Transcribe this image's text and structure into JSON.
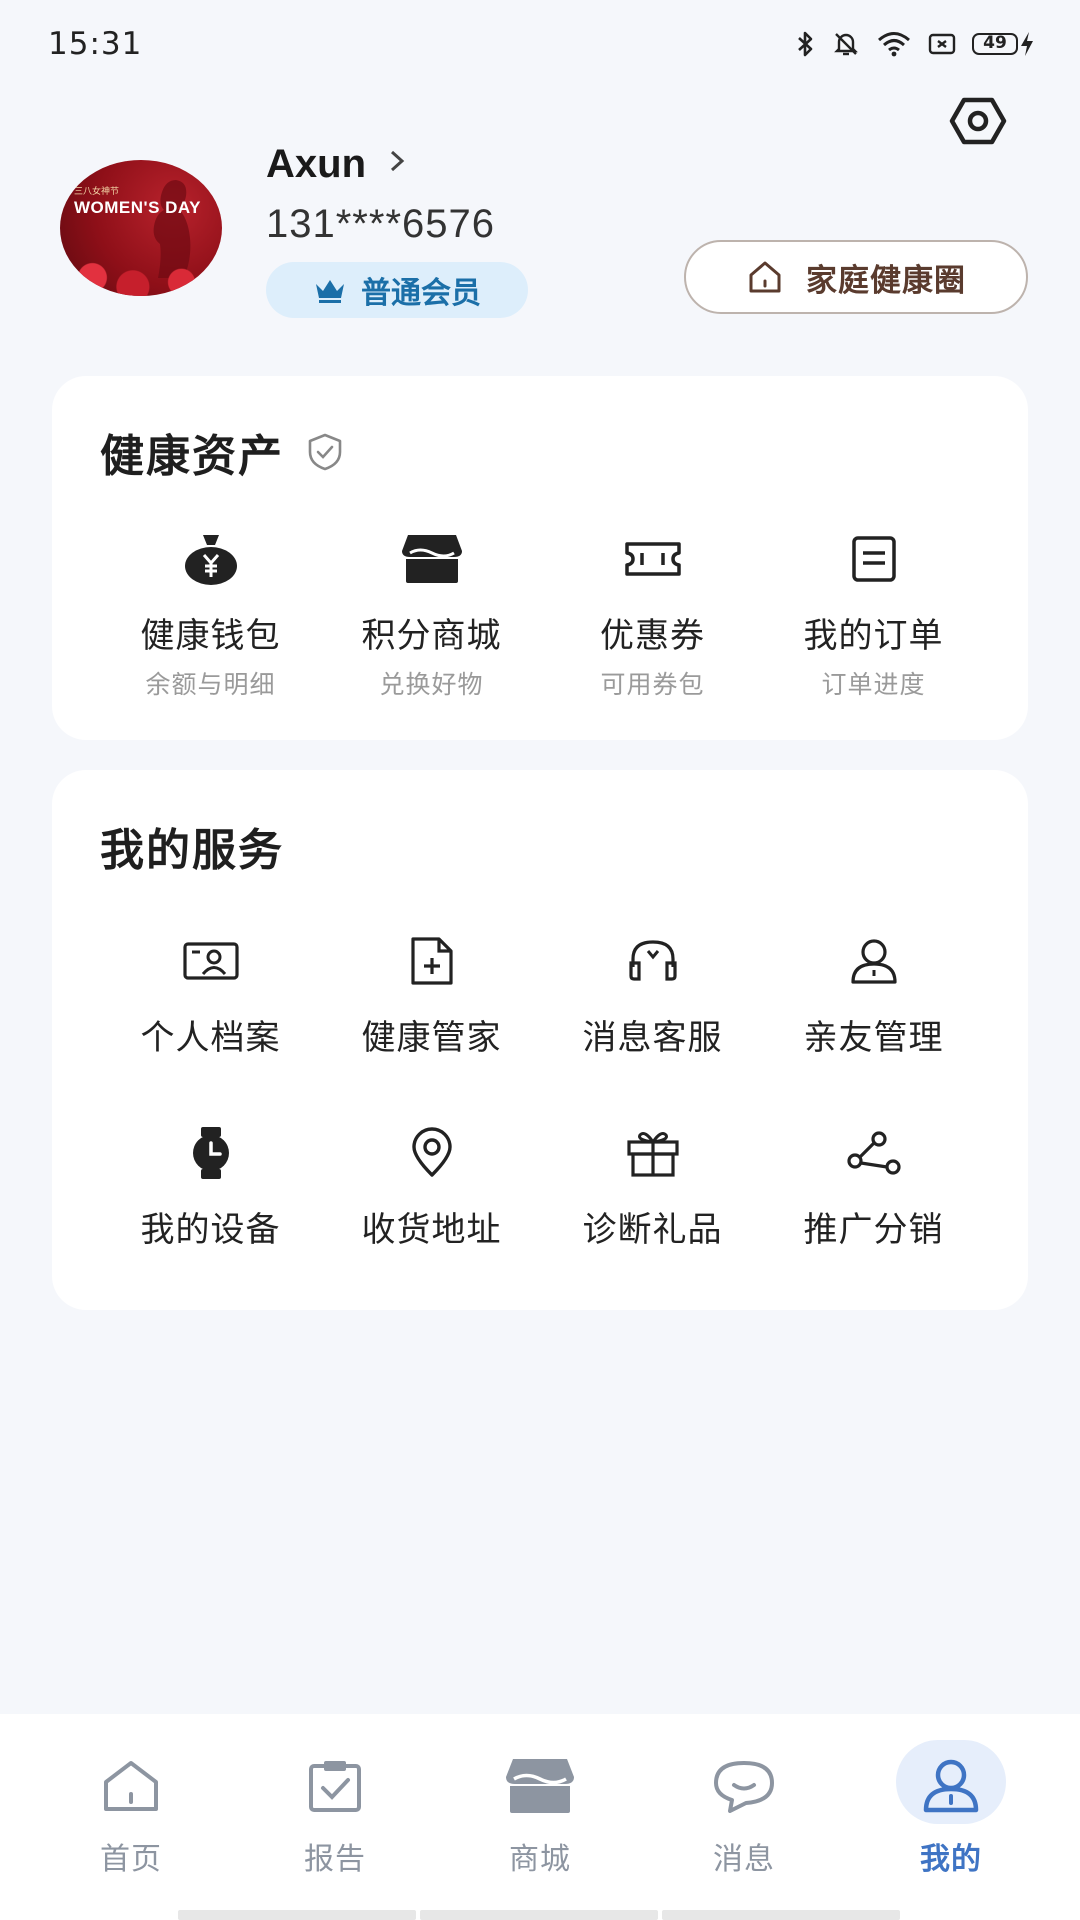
{
  "status_bar": {
    "time": "15:31",
    "battery": "49"
  },
  "profile": {
    "username": "Axun",
    "phone": "131****6576",
    "member_level": "普通会员",
    "family_circle_label": "家庭健康圈",
    "avatar_text": "WOMEN'S DAY"
  },
  "assets": {
    "title": "健康资产",
    "items": [
      {
        "label": "健康钱包",
        "sub": "余额与明细",
        "icon": "money-bag-icon"
      },
      {
        "label": "积分商城",
        "sub": "兑换好物",
        "icon": "store-icon"
      },
      {
        "label": "优惠券",
        "sub": "可用券包",
        "icon": "ticket-icon"
      },
      {
        "label": "我的订单",
        "sub": "订单进度",
        "icon": "order-list-icon"
      }
    ]
  },
  "services": {
    "title": "我的服务",
    "items": [
      {
        "label": "个人档案",
        "icon": "profile-card-icon"
      },
      {
        "label": "健康管家",
        "icon": "add-document-icon"
      },
      {
        "label": "消息客服",
        "icon": "headset-icon"
      },
      {
        "label": "亲友管理",
        "icon": "person-icon"
      },
      {
        "label": "我的设备",
        "icon": "watch-icon"
      },
      {
        "label": "收货地址",
        "icon": "location-pin-icon"
      },
      {
        "label": "诊断礼品",
        "icon": "gift-icon"
      },
      {
        "label": "推广分销",
        "icon": "share-icon"
      }
    ]
  },
  "bottom_nav": {
    "items": [
      {
        "label": "首页",
        "icon": "home-icon"
      },
      {
        "label": "报告",
        "icon": "report-clipboard-icon"
      },
      {
        "label": "商城",
        "icon": "mall-icon"
      },
      {
        "label": "消息",
        "icon": "chat-bubble-icon"
      },
      {
        "label": "我的",
        "icon": "user-icon"
      }
    ],
    "active": "我的"
  },
  "colors": {
    "accent": "#3f74c4",
    "member_badge_bg": "#ddeefb",
    "member_badge_text": "#1b6fa8",
    "family_btn_text": "#5a3b2e"
  }
}
